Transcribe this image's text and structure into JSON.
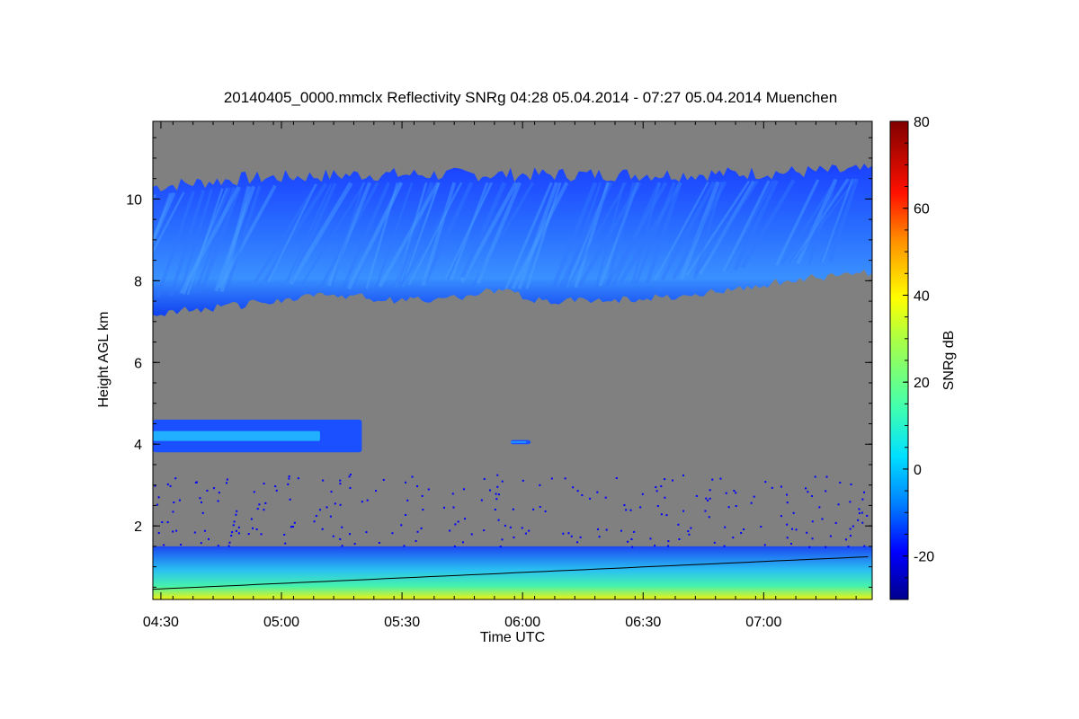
{
  "chart_data": {
    "type": "heatmap",
    "title": "20140405_0000.mmclx Reflectivity SNRg   04:28 05.04.2014 - 07:27 05.04.2014 Muenchen",
    "xlabel": "Time UTC",
    "ylabel": "Height AGL km",
    "colorbar_label": "SNRg dB",
    "x_ticks": [
      "04:30",
      "05:00",
      "05:30",
      "06:00",
      "06:30",
      "07:00"
    ],
    "x_tick_minutes": [
      270,
      300,
      330,
      360,
      390,
      420
    ],
    "xlim_minutes": [
      268,
      447
    ],
    "y_ticks": [
      2,
      4,
      6,
      8,
      10
    ],
    "ylim": [
      0.2,
      11.9
    ],
    "colorbar_ticks": [
      -20,
      0,
      20,
      40,
      60,
      80
    ],
    "colorbar_range": [
      -30,
      80
    ],
    "no_signal_color": "#808080",
    "colormap": [
      "#00008c",
      "#0000ff",
      "#0080ff",
      "#00e0ff",
      "#40ffb0",
      "#b0ff40",
      "#ffff00",
      "#ff9000",
      "#ff1000",
      "#a00000",
      "#800000"
    ],
    "features": [
      {
        "name": "cirrus",
        "t_start": 268,
        "t_end": 447,
        "base_km_at": [
          [
            268,
            7.2
          ],
          [
            290,
            7.4
          ],
          [
            310,
            7.7
          ],
          [
            330,
            7.5
          ],
          [
            345,
            7.6
          ],
          [
            355,
            7.8
          ],
          [
            363,
            7.5
          ],
          [
            375,
            7.5
          ],
          [
            395,
            7.6
          ],
          [
            415,
            7.8
          ],
          [
            425,
            8.0
          ],
          [
            447,
            8.2
          ]
        ],
        "top_km_at": [
          [
            268,
            10.3
          ],
          [
            290,
            10.5
          ],
          [
            320,
            10.6
          ],
          [
            360,
            10.6
          ],
          [
            400,
            10.6
          ],
          [
            447,
            10.7
          ]
        ],
        "snr_db": -5
      },
      {
        "name": "mid-level layer",
        "t_start": 268,
        "t_end": 320,
        "base_km": 3.8,
        "top_km": 4.6,
        "snr_db": -3
      },
      {
        "name": "small echo",
        "t_start": 357,
        "t_end": 362,
        "base_km": 4.0,
        "top_km": 4.1,
        "snr_db": -10
      },
      {
        "name": "boundary layer",
        "t_start": 268,
        "t_end": 447,
        "base_km": 0.2,
        "top_km": 1.5,
        "snr_db": 25
      }
    ]
  }
}
